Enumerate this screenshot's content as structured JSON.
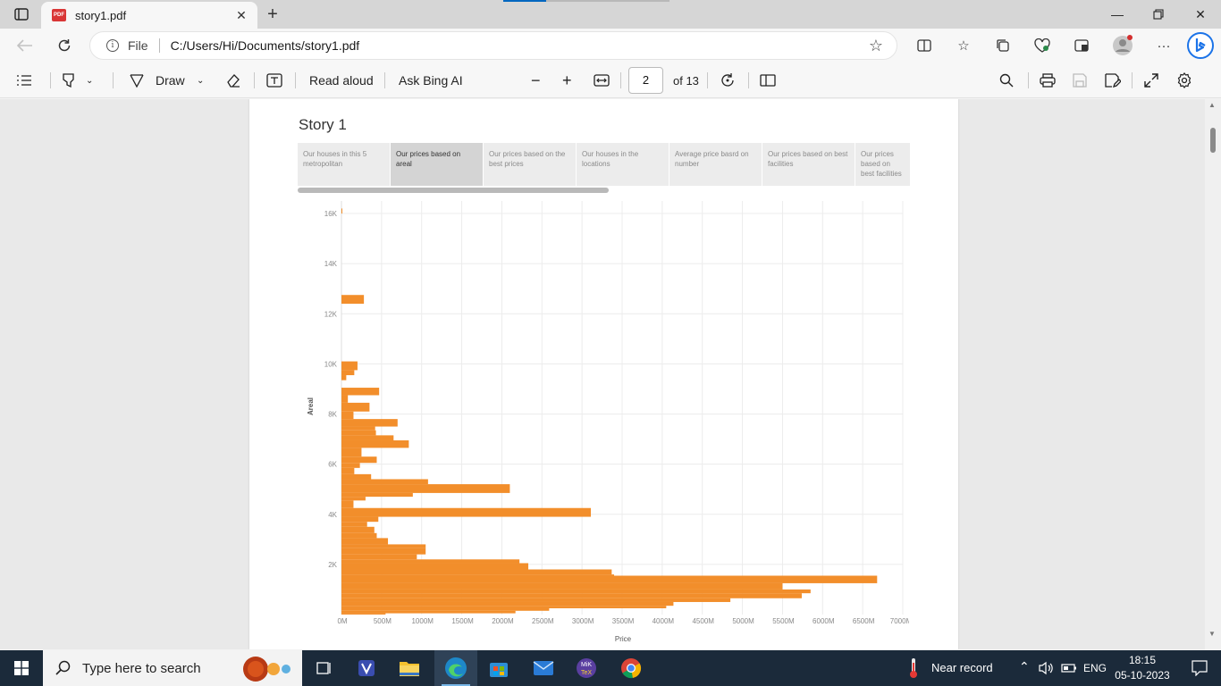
{
  "browser": {
    "tab_title": "story1.pdf",
    "address_scheme": "File",
    "address_url": "C:/Users/Hi/Documents/story1.pdf"
  },
  "pdf_toolbar": {
    "draw_label": "Draw",
    "read_aloud_label": "Read aloud",
    "ask_bing_label": "Ask Bing AI",
    "page_number": "2",
    "page_total": "of 13"
  },
  "story": {
    "title": "Story 1",
    "points": [
      "Our houses in this 5 metropolitan",
      "Our prices based on areal",
      "Our prices based on the best prices",
      "Our houses in the locations",
      "Average price basrd on number",
      "Our prices based on best facilities",
      "Our prices based on best facilities"
    ],
    "active_point": 1
  },
  "chart_data": {
    "type": "bar",
    "orientation": "horizontal",
    "color": "#F28E2B",
    "xlabel": "Price",
    "ylabel": "Areal",
    "xlim": [
      0,
      7000
    ],
    "ylim": [
      0,
      16500
    ],
    "x_tick_labels": [
      "0M",
      "500M",
      "1000M",
      "1500M",
      "2000M",
      "2500M",
      "3000M",
      "3500M",
      "4000M",
      "4500M",
      "5000M",
      "5500M",
      "6000M",
      "6500M",
      "7000M"
    ],
    "x_ticks": [
      0,
      500,
      1000,
      1500,
      2000,
      2500,
      3000,
      3500,
      4000,
      4500,
      5000,
      5500,
      6000,
      6500,
      7000
    ],
    "y_tick_labels": [
      "2K",
      "4K",
      "6K",
      "8K",
      "10K",
      "12K",
      "14K",
      "16K"
    ],
    "y_ticks": [
      2000,
      4000,
      6000,
      8000,
      10000,
      12000,
      14000,
      16000
    ],
    "grid": true,
    "bars": [
      {
        "y_from": 16000,
        "y_to": 16200,
        "value": 10
      },
      {
        "y_from": 12400,
        "y_to": 12750,
        "value": 280
      },
      {
        "y_from": 9750,
        "y_to": 10100,
        "value": 200
      },
      {
        "y_from": 9550,
        "y_to": 9750,
        "value": 160
      },
      {
        "y_from": 9350,
        "y_to": 9550,
        "value": 60
      },
      {
        "y_from": 8750,
        "y_to": 9050,
        "value": 470
      },
      {
        "y_from": 8450,
        "y_to": 8750,
        "value": 80
      },
      {
        "y_from": 8100,
        "y_to": 8450,
        "value": 350
      },
      {
        "y_from": 7800,
        "y_to": 8100,
        "value": 150
      },
      {
        "y_from": 7500,
        "y_to": 7800,
        "value": 700
      },
      {
        "y_from": 7350,
        "y_to": 7500,
        "value": 420
      },
      {
        "y_from": 7150,
        "y_to": 7350,
        "value": 430
      },
      {
        "y_from": 6950,
        "y_to": 7150,
        "value": 650
      },
      {
        "y_from": 6650,
        "y_to": 6950,
        "value": 840
      },
      {
        "y_from": 6300,
        "y_to": 6650,
        "value": 250
      },
      {
        "y_from": 6050,
        "y_to": 6300,
        "value": 440
      },
      {
        "y_from": 5850,
        "y_to": 6050,
        "value": 230
      },
      {
        "y_from": 5600,
        "y_to": 5850,
        "value": 160
      },
      {
        "y_from": 5400,
        "y_to": 5600,
        "value": 370
      },
      {
        "y_from": 5200,
        "y_to": 5400,
        "value": 1080
      },
      {
        "y_from": 4850,
        "y_to": 5200,
        "value": 2100
      },
      {
        "y_from": 4700,
        "y_to": 4850,
        "value": 890
      },
      {
        "y_from": 4550,
        "y_to": 4700,
        "value": 300
      },
      {
        "y_from": 4250,
        "y_to": 4550,
        "value": 150
      },
      {
        "y_from": 3900,
        "y_to": 4250,
        "value": 3110
      },
      {
        "y_from": 3700,
        "y_to": 3900,
        "value": 460
      },
      {
        "y_from": 3500,
        "y_to": 3700,
        "value": 320
      },
      {
        "y_from": 3250,
        "y_to": 3500,
        "value": 410
      },
      {
        "y_from": 3050,
        "y_to": 3250,
        "value": 440
      },
      {
        "y_from": 2800,
        "y_to": 3050,
        "value": 580
      },
      {
        "y_from": 2650,
        "y_to": 2800,
        "value": 1050
      },
      {
        "y_from": 2400,
        "y_to": 2650,
        "value": 1050
      },
      {
        "y_from": 2200,
        "y_to": 2400,
        "value": 940
      },
      {
        "y_from": 2050,
        "y_to": 2200,
        "value": 2220
      },
      {
        "y_from": 1800,
        "y_to": 2050,
        "value": 2330
      },
      {
        "y_from": 1600,
        "y_to": 1800,
        "value": 3370
      },
      {
        "y_from": 1550,
        "y_to": 1600,
        "value": 3400
      },
      {
        "y_from": 1250,
        "y_to": 1550,
        "value": 6680
      },
      {
        "y_from": 1000,
        "y_to": 1250,
        "value": 5500
      },
      {
        "y_from": 850,
        "y_to": 1000,
        "value": 5850
      },
      {
        "y_from": 650,
        "y_to": 850,
        "value": 5740
      },
      {
        "y_from": 500,
        "y_to": 650,
        "value": 4850
      },
      {
        "y_from": 350,
        "y_to": 500,
        "value": 4140
      },
      {
        "y_from": 250,
        "y_to": 350,
        "value": 4050
      },
      {
        "y_from": 150,
        "y_to": 250,
        "value": 2590
      },
      {
        "y_from": 50,
        "y_to": 150,
        "value": 2170
      },
      {
        "y_from": 0,
        "y_to": 50,
        "value": 550
      }
    ]
  },
  "taskbar": {
    "search_placeholder": "Type here to search",
    "weather_text": "Near record",
    "language": "ENG",
    "time": "18:15",
    "date": "05-10-2023"
  }
}
